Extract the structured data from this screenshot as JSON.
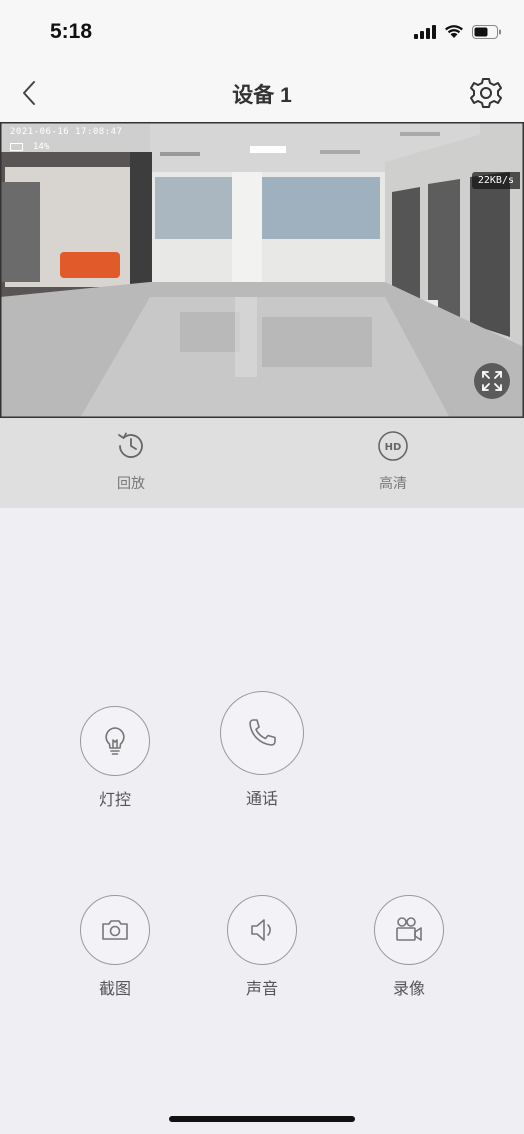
{
  "status_bar": {
    "time": "5:18"
  },
  "nav": {
    "title": "设备 1"
  },
  "video": {
    "timestamp": "2021-06-16 17:08:47",
    "battery_text": "14%",
    "bitrate": "22KB/s"
  },
  "controls": {
    "playback_label": "回放",
    "quality_label": "高清",
    "quality_badge": "HD"
  },
  "functions": {
    "light_label": "灯控",
    "call_label": "通话",
    "screenshot_label": "截图",
    "sound_label": "声音",
    "record_label": "录像"
  },
  "icons": [
    "back-arrow-icon",
    "gear-icon",
    "history-icon",
    "hd-icon",
    "fullscreen-icon",
    "lightbulb-icon",
    "phone-icon",
    "camera-icon",
    "speaker-icon",
    "video-camera-icon"
  ]
}
